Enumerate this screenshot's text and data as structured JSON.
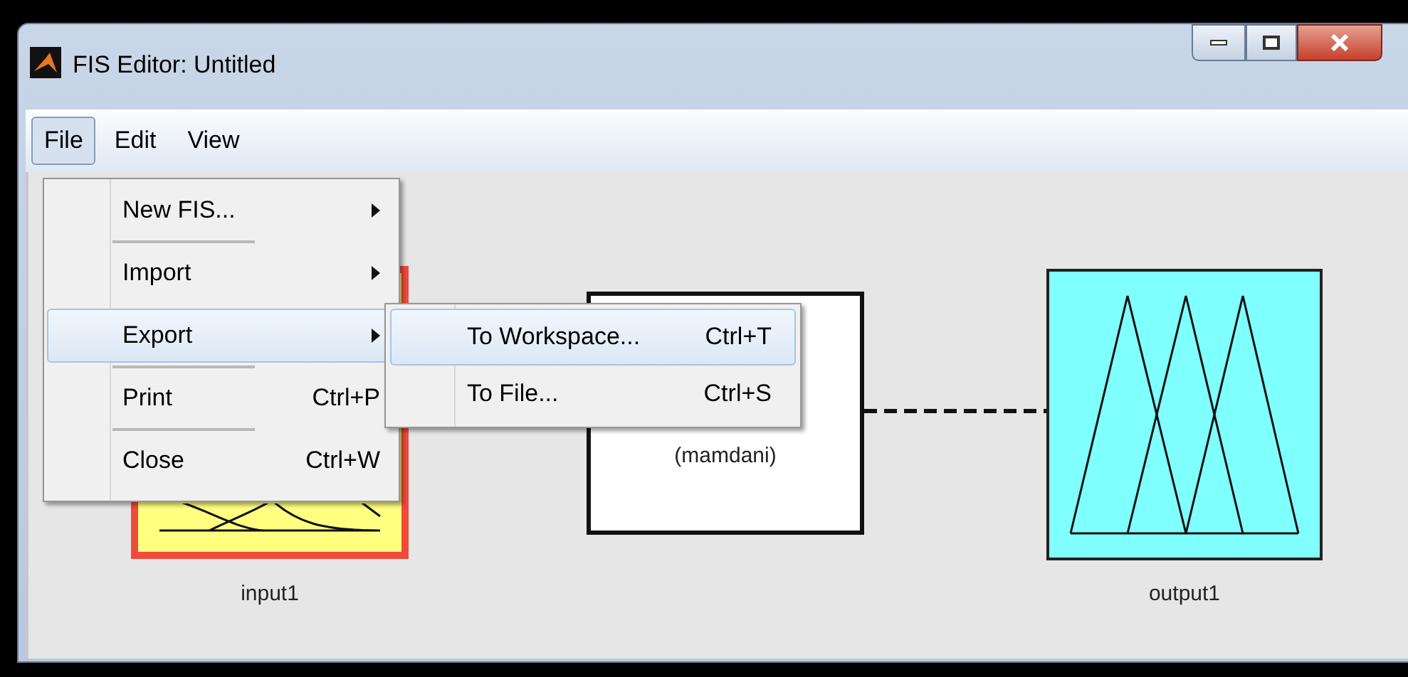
{
  "window": {
    "title": "FIS Editor: Untitled"
  },
  "menu_bar": [
    {
      "label": "File",
      "selected": true
    },
    {
      "label": "Edit",
      "selected": false
    },
    {
      "label": "View",
      "selected": false
    }
  ],
  "file_menu": [
    {
      "label": "New FIS...",
      "submenu": true,
      "selected": false,
      "separator_after": true
    },
    {
      "label": "Import",
      "submenu": true,
      "selected": false,
      "separator_after": false
    },
    {
      "label": "Export",
      "submenu": true,
      "selected": true,
      "separator_after": true
    },
    {
      "label": "Print",
      "shortcut": "Ctrl+P",
      "submenu": false,
      "selected": false,
      "separator_after": true
    },
    {
      "label": "Close",
      "shortcut": "Ctrl+W",
      "submenu": false,
      "selected": false,
      "separator_after": false
    }
  ],
  "export_submenu": [
    {
      "label": "To Workspace...",
      "shortcut": "Ctrl+T",
      "selected": true
    },
    {
      "label": "To File...",
      "shortcut": "Ctrl+S",
      "selected": false
    }
  ],
  "diagram": {
    "input": {
      "label": "input1",
      "selected": true
    },
    "system": {
      "subtitle": "(mamdani)"
    },
    "output": {
      "label": "output1"
    }
  }
}
